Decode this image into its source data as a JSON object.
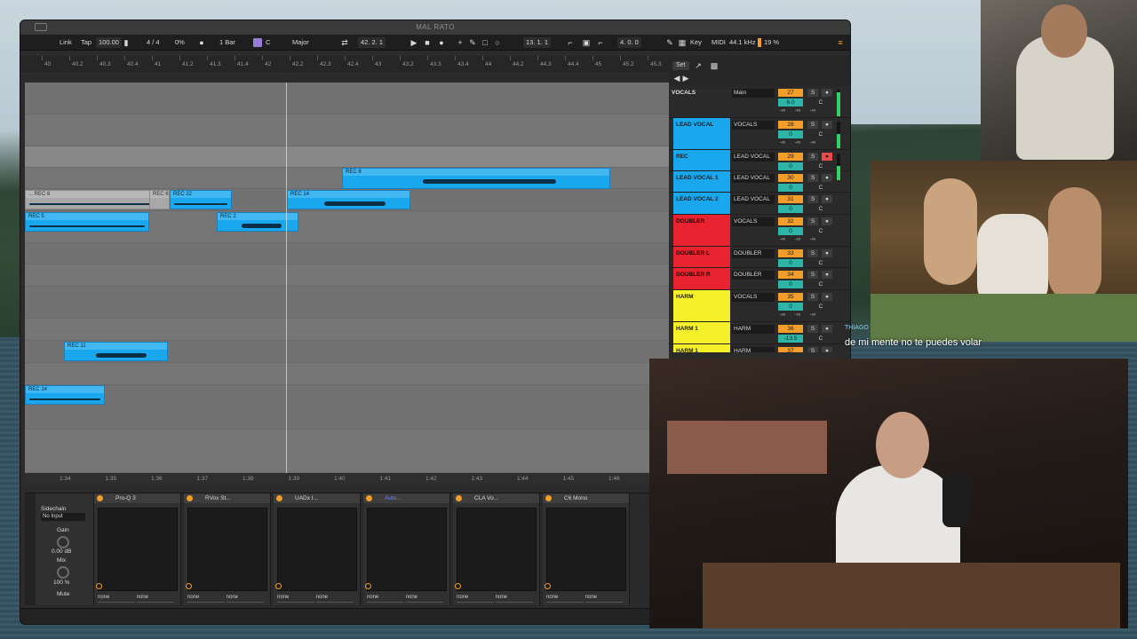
{
  "window": {
    "title": "MAL RATO"
  },
  "controlbar": {
    "link": "Link",
    "tap": "Tap",
    "tempo": "100.00",
    "meter": "4 / 4",
    "swing": "0%",
    "quantize": "1 Bar",
    "key_root": "C",
    "scale": "Major",
    "position": "42.  2.  1",
    "loop_start": "13.  1.  1",
    "loop_length": "4.  0.  0",
    "key_label": "Key",
    "midi_label": "MIDI",
    "sample_rate": "44.1 kHz",
    "cpu": "19 %"
  },
  "ruler": {
    "ticks": [
      "40",
      "40.2",
      "40.3",
      "40.4",
      "41",
      "41.2",
      "41.3",
      "41.4",
      "42",
      "42.2",
      "42.3",
      "42.4",
      "43",
      "43.2",
      "43.3",
      "43.4",
      "44",
      "44.2",
      "44.3",
      "44.4",
      "45",
      "45.2",
      "45.3"
    ],
    "set_label": "Set"
  },
  "clips": {
    "rec8": "REC 8",
    "rec6a": "... REC 6",
    "rec6b": "REC 6",
    "rec22": "REC 22",
    "rec14a": "REC 14",
    "rec5": "REC 5",
    "rec2": "REC 2",
    "rec11": "REC 11",
    "rec14b": "REC 14"
  },
  "tracks": [
    {
      "name": "VOCALS",
      "route": "Main",
      "num": "27",
      "vol": "6.0",
      "color": "#2a2a2a"
    },
    {
      "name": "LEAD VOCAL",
      "route": "VOCALS",
      "num": "28",
      "vol": "0",
      "color": "#19a8ee"
    },
    {
      "name": "REC",
      "route": "LEAD VOCAL",
      "num": "29",
      "vol": "0",
      "color": "#19a8ee"
    },
    {
      "name": "LEAD VOCAL 1",
      "route": "LEAD VOCAL",
      "num": "30",
      "vol": "0",
      "color": "#19a8ee"
    },
    {
      "name": "LEAD VOCAL 2",
      "route": "LEAD VOCAL",
      "num": "31",
      "vol": "0",
      "color": "#19a8ee"
    },
    {
      "name": "DOUBLER",
      "route": "VOCALS",
      "num": "32",
      "vol": "0",
      "color": "#e8232f"
    },
    {
      "name": "DOUBLER L",
      "route": "DOUBLER",
      "num": "33",
      "vol": "0",
      "color": "#e8232f"
    },
    {
      "name": "DOUBLER R",
      "route": "DOUBLER",
      "num": "34",
      "vol": "0",
      "color": "#e8232f"
    },
    {
      "name": "HARM",
      "route": "VOCALS",
      "num": "35",
      "vol": "0",
      "color": "#f5f02a"
    },
    {
      "name": "HARM 1",
      "route": "HARM",
      "num": "36",
      "vol": "-13.5",
      "color": "#f5f02a"
    },
    {
      "name": "HARM 1",
      "route": "HARM",
      "num": "37",
      "vol": "",
      "color": "#f5f02a"
    }
  ],
  "track_common": {
    "solo": "S",
    "center": "C",
    "neg_inf": "-∞"
  },
  "timeline": [
    "1:34",
    "1:35",
    "1:36",
    "1:37",
    "1:38",
    "1:39",
    "1:40",
    "1:41",
    "1:42",
    "1:43",
    "1:44",
    "1:45",
    "1:46"
  ],
  "devices": {
    "sidechain": "Sidechain",
    "input": "No Input",
    "gain_label": "Gain",
    "gain_value": "0.00 dB",
    "mix_label": "Mix",
    "mix_value": "100 %",
    "mute": "Mute",
    "chain": [
      "Pro-Q 3",
      "RVox St...",
      "UADx I...",
      "Auto...",
      "CLA Vo...",
      "C6 Mono"
    ],
    "none": "none"
  },
  "stream": {
    "user": "THIAGO",
    "caption": "de mi mente no te puedes volar"
  }
}
